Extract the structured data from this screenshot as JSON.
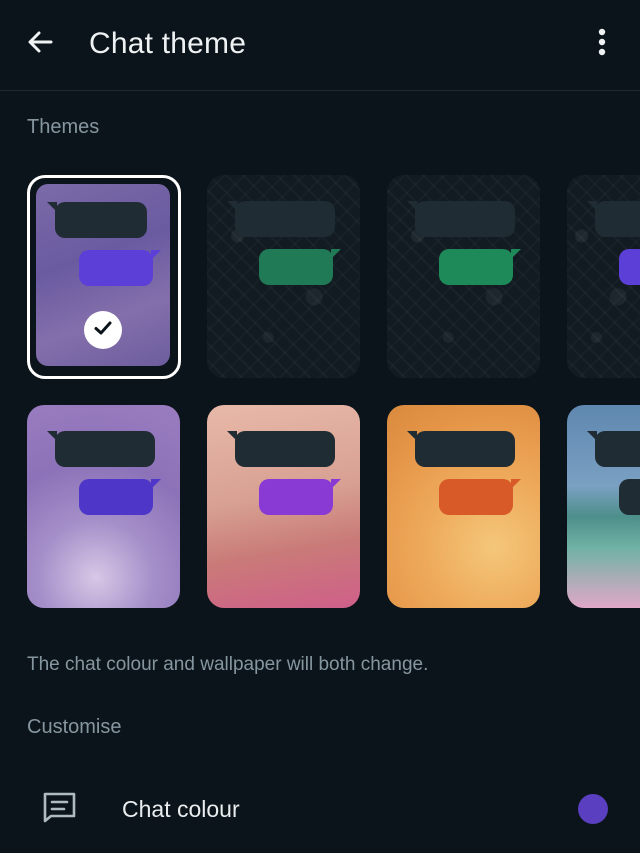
{
  "header": {
    "title": "Chat theme",
    "back_icon": "arrow-left-icon",
    "more_icon": "more-vertical-icon"
  },
  "themes_section": {
    "label": "Themes",
    "selected_index": 0,
    "themes": [
      {
        "style": "purple-haze",
        "bubble_color": "#5b3fd6"
      },
      {
        "style": "dark-doodle",
        "bubble_color": "#1f7a55"
      },
      {
        "style": "dark-doodle",
        "bubble_color": "#1e8a5a"
      },
      {
        "style": "dark-doodle",
        "bubble_color": "#5b3fd6"
      },
      {
        "style": "purple-rays",
        "bubble_color": "#4d36c8"
      },
      {
        "style": "pink-floral",
        "bubble_color": "#8a3ad4"
      },
      {
        "style": "orange-glow",
        "bubble_color": "#d75a28"
      },
      {
        "style": "beach",
        "bubble_color": "#1f2c33"
      }
    ],
    "description": "The chat colour and wallpaper will both change."
  },
  "customise_section": {
    "label": "Customise",
    "chat_colour": {
      "label": "Chat colour",
      "icon": "chat-bubble-lines-icon",
      "color": "#5a3fc0"
    }
  }
}
